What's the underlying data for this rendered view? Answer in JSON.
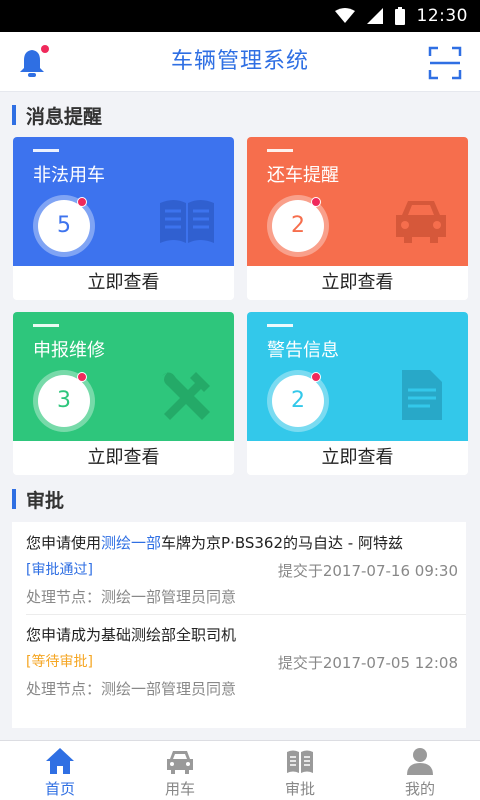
{
  "status_bar": {
    "time": "12:30"
  },
  "app": {
    "title": "车辆管理系统"
  },
  "sections": {
    "messages": "消息提醒",
    "approval": "审批"
  },
  "cards": [
    {
      "label": "非法用车",
      "count": "5",
      "action": "立即查看",
      "color": "#3d73ee",
      "icon": "book-icon"
    },
    {
      "label": "还车提醒",
      "count": "2",
      "action": "立即查看",
      "color": "#f66e4d",
      "icon": "car-icon"
    },
    {
      "label": "申报维修",
      "count": "3",
      "action": "立即查看",
      "color": "#2ec67c",
      "icon": "tools-icon"
    },
    {
      "label": "警告信息",
      "count": "2",
      "action": "立即查看",
      "color": "#33c8ea",
      "icon": "document-icon"
    }
  ],
  "approvals": [
    {
      "text_before": "您申请使用",
      "dept": "测绘一部",
      "text_after": "车牌为京P·BS362的马自达 - 阿特兹",
      "status": "[审批通过]",
      "status_color": "#2f6fe3",
      "date": "提交于2017-07-16 09:30",
      "node": "处理节点：测绘一部管理员同意"
    },
    {
      "text_before": "您申请成为基础测绘部全职司机",
      "dept": "",
      "text_after": "",
      "status": "[等待审批]",
      "status_color": "#f5a623",
      "date": "提交于2017-07-05 12:08",
      "node": "处理节点：测绘一部管理员同意"
    }
  ],
  "tabs": [
    {
      "label": "首页",
      "icon": "home-icon",
      "active": true
    },
    {
      "label": "用车",
      "icon": "car-icon",
      "active": false
    },
    {
      "label": "审批",
      "icon": "book-icon",
      "active": false
    },
    {
      "label": "我的",
      "icon": "person-icon",
      "active": false
    }
  ],
  "colors": {
    "accent": "#2f6fe3",
    "badge": "#f0295b"
  }
}
